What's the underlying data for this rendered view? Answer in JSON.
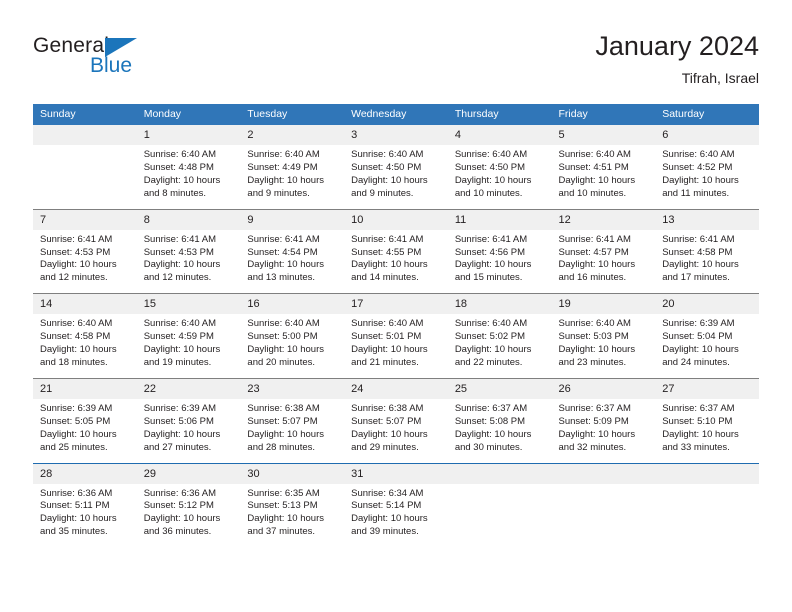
{
  "brand": {
    "name_top": "General",
    "name_bottom": "Blue",
    "accent_color": "#1b75bb"
  },
  "header": {
    "title": "January 2024",
    "subtitle": "Tifrah, Israel"
  },
  "colors": {
    "header_row_bg": "#3076b8",
    "daynum_bg": "#f0f0f0",
    "text": "#231f20",
    "week_divider": "#7f7f7f",
    "last_divider": "#1f6cb0"
  },
  "weekday_headers": [
    "Sunday",
    "Monday",
    "Tuesday",
    "Wednesday",
    "Thursday",
    "Friday",
    "Saturday"
  ],
  "labels": {
    "sunrise_prefix": "Sunrise:",
    "sunset_prefix": "Sunset:",
    "daylight_prefix": "Daylight:"
  },
  "weeks": [
    [
      {
        "day": "",
        "line1": "",
        "line2": "",
        "line3": "",
        "line4": ""
      },
      {
        "day": "1",
        "line1": "Sunrise: 6:40 AM",
        "line2": "Sunset: 4:48 PM",
        "line3": "Daylight: 10 hours",
        "line4": "and 8 minutes."
      },
      {
        "day": "2",
        "line1": "Sunrise: 6:40 AM",
        "line2": "Sunset: 4:49 PM",
        "line3": "Daylight: 10 hours",
        "line4": "and 9 minutes."
      },
      {
        "day": "3",
        "line1": "Sunrise: 6:40 AM",
        "line2": "Sunset: 4:50 PM",
        "line3": "Daylight: 10 hours",
        "line4": "and 9 minutes."
      },
      {
        "day": "4",
        "line1": "Sunrise: 6:40 AM",
        "line2": "Sunset: 4:50 PM",
        "line3": "Daylight: 10 hours",
        "line4": "and 10 minutes."
      },
      {
        "day": "5",
        "line1": "Sunrise: 6:40 AM",
        "line2": "Sunset: 4:51 PM",
        "line3": "Daylight: 10 hours",
        "line4": "and 10 minutes."
      },
      {
        "day": "6",
        "line1": "Sunrise: 6:40 AM",
        "line2": "Sunset: 4:52 PM",
        "line3": "Daylight: 10 hours",
        "line4": "and 11 minutes."
      }
    ],
    [
      {
        "day": "7",
        "line1": "Sunrise: 6:41 AM",
        "line2": "Sunset: 4:53 PM",
        "line3": "Daylight: 10 hours",
        "line4": "and 12 minutes."
      },
      {
        "day": "8",
        "line1": "Sunrise: 6:41 AM",
        "line2": "Sunset: 4:53 PM",
        "line3": "Daylight: 10 hours",
        "line4": "and 12 minutes."
      },
      {
        "day": "9",
        "line1": "Sunrise: 6:41 AM",
        "line2": "Sunset: 4:54 PM",
        "line3": "Daylight: 10 hours",
        "line4": "and 13 minutes."
      },
      {
        "day": "10",
        "line1": "Sunrise: 6:41 AM",
        "line2": "Sunset: 4:55 PM",
        "line3": "Daylight: 10 hours",
        "line4": "and 14 minutes."
      },
      {
        "day": "11",
        "line1": "Sunrise: 6:41 AM",
        "line2": "Sunset: 4:56 PM",
        "line3": "Daylight: 10 hours",
        "line4": "and 15 minutes."
      },
      {
        "day": "12",
        "line1": "Sunrise: 6:41 AM",
        "line2": "Sunset: 4:57 PM",
        "line3": "Daylight: 10 hours",
        "line4": "and 16 minutes."
      },
      {
        "day": "13",
        "line1": "Sunrise: 6:41 AM",
        "line2": "Sunset: 4:58 PM",
        "line3": "Daylight: 10 hours",
        "line4": "and 17 minutes."
      }
    ],
    [
      {
        "day": "14",
        "line1": "Sunrise: 6:40 AM",
        "line2": "Sunset: 4:58 PM",
        "line3": "Daylight: 10 hours",
        "line4": "and 18 minutes."
      },
      {
        "day": "15",
        "line1": "Sunrise: 6:40 AM",
        "line2": "Sunset: 4:59 PM",
        "line3": "Daylight: 10 hours",
        "line4": "and 19 minutes."
      },
      {
        "day": "16",
        "line1": "Sunrise: 6:40 AM",
        "line2": "Sunset: 5:00 PM",
        "line3": "Daylight: 10 hours",
        "line4": "and 20 minutes."
      },
      {
        "day": "17",
        "line1": "Sunrise: 6:40 AM",
        "line2": "Sunset: 5:01 PM",
        "line3": "Daylight: 10 hours",
        "line4": "and 21 minutes."
      },
      {
        "day": "18",
        "line1": "Sunrise: 6:40 AM",
        "line2": "Sunset: 5:02 PM",
        "line3": "Daylight: 10 hours",
        "line4": "and 22 minutes."
      },
      {
        "day": "19",
        "line1": "Sunrise: 6:40 AM",
        "line2": "Sunset: 5:03 PM",
        "line3": "Daylight: 10 hours",
        "line4": "and 23 minutes."
      },
      {
        "day": "20",
        "line1": "Sunrise: 6:39 AM",
        "line2": "Sunset: 5:04 PM",
        "line3": "Daylight: 10 hours",
        "line4": "and 24 minutes."
      }
    ],
    [
      {
        "day": "21",
        "line1": "Sunrise: 6:39 AM",
        "line2": "Sunset: 5:05 PM",
        "line3": "Daylight: 10 hours",
        "line4": "and 25 minutes."
      },
      {
        "day": "22",
        "line1": "Sunrise: 6:39 AM",
        "line2": "Sunset: 5:06 PM",
        "line3": "Daylight: 10 hours",
        "line4": "and 27 minutes."
      },
      {
        "day": "23",
        "line1": "Sunrise: 6:38 AM",
        "line2": "Sunset: 5:07 PM",
        "line3": "Daylight: 10 hours",
        "line4": "and 28 minutes."
      },
      {
        "day": "24",
        "line1": "Sunrise: 6:38 AM",
        "line2": "Sunset: 5:07 PM",
        "line3": "Daylight: 10 hours",
        "line4": "and 29 minutes."
      },
      {
        "day": "25",
        "line1": "Sunrise: 6:37 AM",
        "line2": "Sunset: 5:08 PM",
        "line3": "Daylight: 10 hours",
        "line4": "and 30 minutes."
      },
      {
        "day": "26",
        "line1": "Sunrise: 6:37 AM",
        "line2": "Sunset: 5:09 PM",
        "line3": "Daylight: 10 hours",
        "line4": "and 32 minutes."
      },
      {
        "day": "27",
        "line1": "Sunrise: 6:37 AM",
        "line2": "Sunset: 5:10 PM",
        "line3": "Daylight: 10 hours",
        "line4": "and 33 minutes."
      }
    ],
    [
      {
        "day": "28",
        "line1": "Sunrise: 6:36 AM",
        "line2": "Sunset: 5:11 PM",
        "line3": "Daylight: 10 hours",
        "line4": "and 35 minutes."
      },
      {
        "day": "29",
        "line1": "Sunrise: 6:36 AM",
        "line2": "Sunset: 5:12 PM",
        "line3": "Daylight: 10 hours",
        "line4": "and 36 minutes."
      },
      {
        "day": "30",
        "line1": "Sunrise: 6:35 AM",
        "line2": "Sunset: 5:13 PM",
        "line3": "Daylight: 10 hours",
        "line4": "and 37 minutes."
      },
      {
        "day": "31",
        "line1": "Sunrise: 6:34 AM",
        "line2": "Sunset: 5:14 PM",
        "line3": "Daylight: 10 hours",
        "line4": "and 39 minutes."
      },
      {
        "day": "",
        "line1": "",
        "line2": "",
        "line3": "",
        "line4": ""
      },
      {
        "day": "",
        "line1": "",
        "line2": "",
        "line3": "",
        "line4": ""
      },
      {
        "day": "",
        "line1": "",
        "line2": "",
        "line3": "",
        "line4": ""
      }
    ]
  ]
}
